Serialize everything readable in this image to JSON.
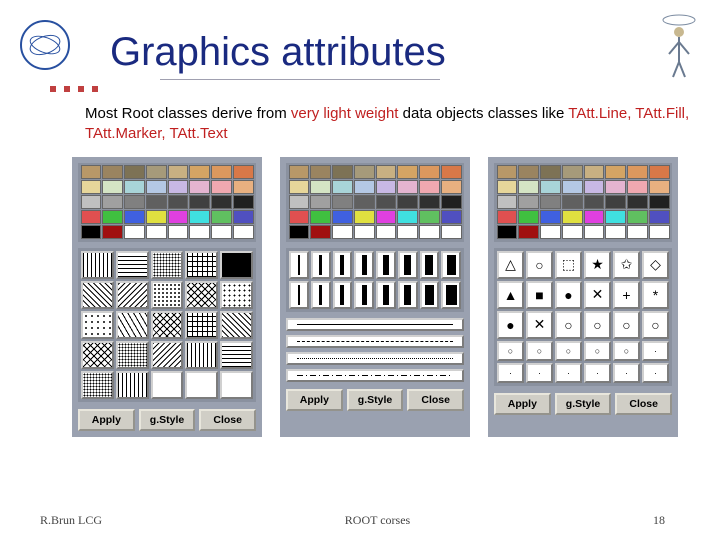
{
  "slide": {
    "title": "Graphics attributes",
    "body_plain": "Most Root classes derive from ",
    "body_hl1": "very light weight",
    "body_mid": " data objects classes like ",
    "body_hl2": "TAtt.Line, TAtt.Fill, TAtt.Marker, TAtt.Text"
  },
  "colors": {
    "row1": [
      "#b89868",
      "#9a8460",
      "#7d7255",
      "#a69a7a",
      "#c8b082",
      "#d4a464",
      "#dc985e",
      "#d87848"
    ],
    "row2": [
      "#e6d69a",
      "#d4e4c4",
      "#a8d4d8",
      "#b4c8e4",
      "#c8b8e4",
      "#e4b4d0",
      "#f0a8b0",
      "#e8b080"
    ],
    "row3": [
      "#c0c0c0",
      "#a0a0a0",
      "#808080",
      "#606060",
      "#505050",
      "#404040",
      "#303030",
      "#202020"
    ],
    "row4": [
      "#e05050",
      "#40c040",
      "#4060e0",
      "#e0e040",
      "#e040e0",
      "#40e0e0",
      "#60c060",
      "#5050c0"
    ],
    "row5": [
      "#000000",
      "#a01010",
      "#ffffff",
      "#ffffff",
      "#ffffff",
      "#ffffff",
      "#ffffff",
      "#ffffff"
    ]
  },
  "markers": [
    "△",
    "○",
    "⬚",
    "★",
    "✩",
    "◇",
    "▲",
    "■",
    "●",
    "✕",
    "+",
    "*",
    "●",
    "✕",
    "○",
    "○",
    "○",
    "○",
    "○",
    "○",
    "○",
    "○",
    "○",
    "·",
    "·",
    "·",
    "·",
    "·",
    "·",
    "·"
  ],
  "buttons": {
    "apply": "Apply",
    "gstyle": "g.Style",
    "close": "Close"
  },
  "footer": {
    "author": "R.Brun LCG",
    "center": "ROOT corses",
    "page": "18"
  }
}
